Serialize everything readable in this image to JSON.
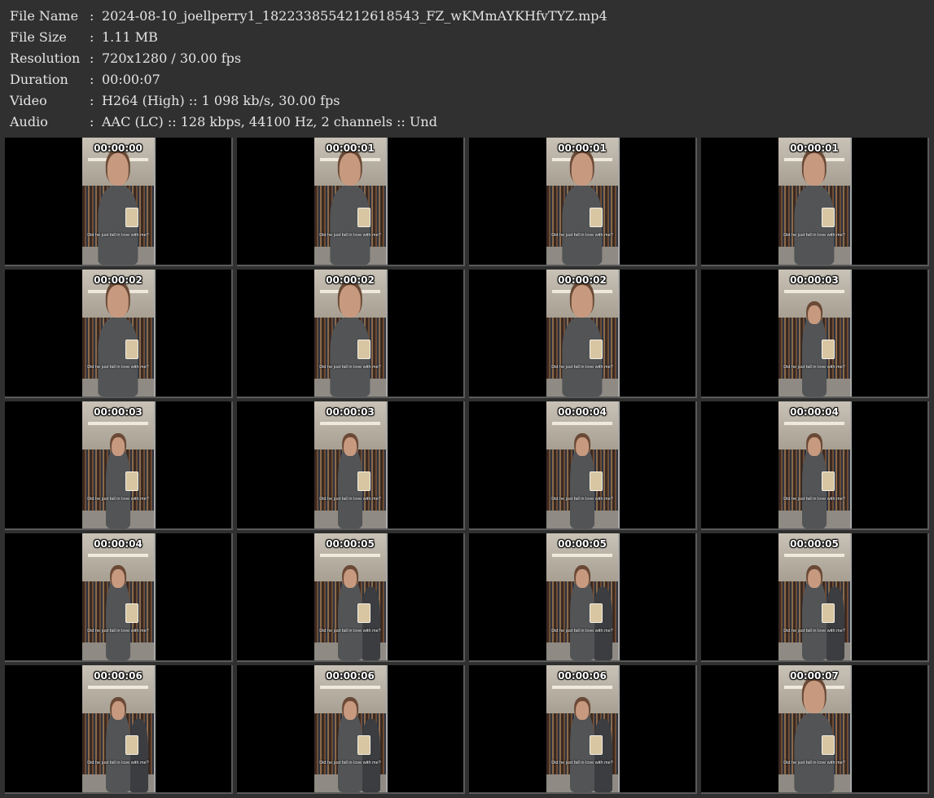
{
  "info": [
    {
      "key": "File Name",
      "sep": ":",
      "value": "2024-08-10_joellperry1_1822338554212618543_FZ_wKMmAYKHfvTYZ.mp4"
    },
    {
      "key": "File Size",
      "sep": ":",
      "value": "1.11 MB"
    },
    {
      "key": "Resolution",
      "sep": ":",
      "value": "720x1280 / 30.00 fps"
    },
    {
      "key": "Duration",
      "sep": ":",
      "value": "00:00:07"
    },
    {
      "key": "Video",
      "sep": ":",
      "value": "H264 (High) :: 1 098 kb/s, 30.00 fps"
    },
    {
      "key": "Audio",
      "sep": ":",
      "value": "AAC (LC) :: 128 kbps, 44100 Hz, 2 channels :: Und"
    }
  ],
  "caption": "Did he just fall in love with me?",
  "thumbnails": [
    {
      "timestamp": "00:00:00",
      "scene": "close"
    },
    {
      "timestamp": "00:00:01",
      "scene": "close"
    },
    {
      "timestamp": "00:00:01",
      "scene": "close"
    },
    {
      "timestamp": "00:00:01",
      "scene": "close"
    },
    {
      "timestamp": "00:00:02",
      "scene": "close"
    },
    {
      "timestamp": "00:00:02",
      "scene": "close"
    },
    {
      "timestamp": "00:00:02",
      "scene": "close"
    },
    {
      "timestamp": "00:00:03",
      "scene": "far"
    },
    {
      "timestamp": "00:00:03",
      "scene": "far"
    },
    {
      "timestamp": "00:00:03",
      "scene": "far"
    },
    {
      "timestamp": "00:00:04",
      "scene": "far"
    },
    {
      "timestamp": "00:00:04",
      "scene": "far"
    },
    {
      "timestamp": "00:00:04",
      "scene": "far"
    },
    {
      "timestamp": "00:00:05",
      "scene": "pair"
    },
    {
      "timestamp": "00:00:05",
      "scene": "pair"
    },
    {
      "timestamp": "00:00:05",
      "scene": "pair"
    },
    {
      "timestamp": "00:00:06",
      "scene": "pair"
    },
    {
      "timestamp": "00:00:06",
      "scene": "pair"
    },
    {
      "timestamp": "00:00:06",
      "scene": "pair"
    },
    {
      "timestamp": "00:00:07",
      "scene": "close"
    }
  ]
}
